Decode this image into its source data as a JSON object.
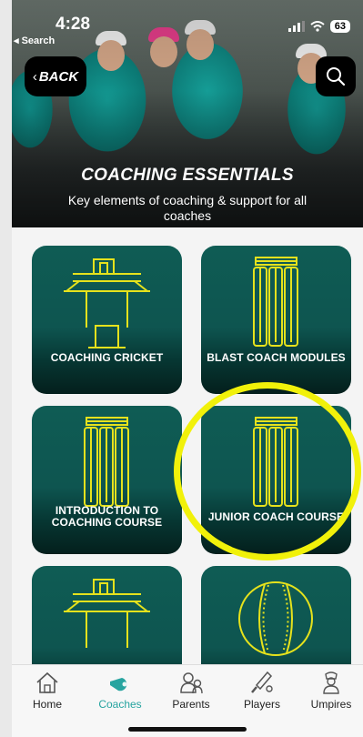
{
  "status_bar": {
    "time": "4:28",
    "back_app": "Search",
    "battery": "63"
  },
  "header": {
    "back_label": "BACK",
    "title": "COACHING ESSENTIALS",
    "subtitle": "Key elements of coaching & support for all coaches"
  },
  "cards": [
    {
      "label": "COACHING CRICKET",
      "icon": "batting-tee-icon"
    },
    {
      "label": "BLAST COACH MODULES",
      "icon": "wickets-icon"
    },
    {
      "label": "INTRODUCTION TO COACHING COURSE",
      "icon": "wickets-icon"
    },
    {
      "label": "JUNIOR COACH COURSE",
      "icon": "wickets-icon"
    },
    {
      "label": "",
      "icon": "batting-tee-icon"
    },
    {
      "label": "",
      "icon": "cricket-ball-icon"
    }
  ],
  "tabs": [
    {
      "label": "Home",
      "icon": "home-icon",
      "active": false
    },
    {
      "label": "Coaches",
      "icon": "whistle-icon",
      "active": true
    },
    {
      "label": "Parents",
      "icon": "parents-icon",
      "active": false
    },
    {
      "label": "Players",
      "icon": "bat-icon",
      "active": false
    },
    {
      "label": "Umpires",
      "icon": "umpire-icon",
      "active": false
    }
  ],
  "colors": {
    "card_bg": "#0f5c54",
    "icon_yellow": "#e6e21c",
    "highlight_ring": "#f1f10a",
    "tab_active": "#27a4a0"
  }
}
